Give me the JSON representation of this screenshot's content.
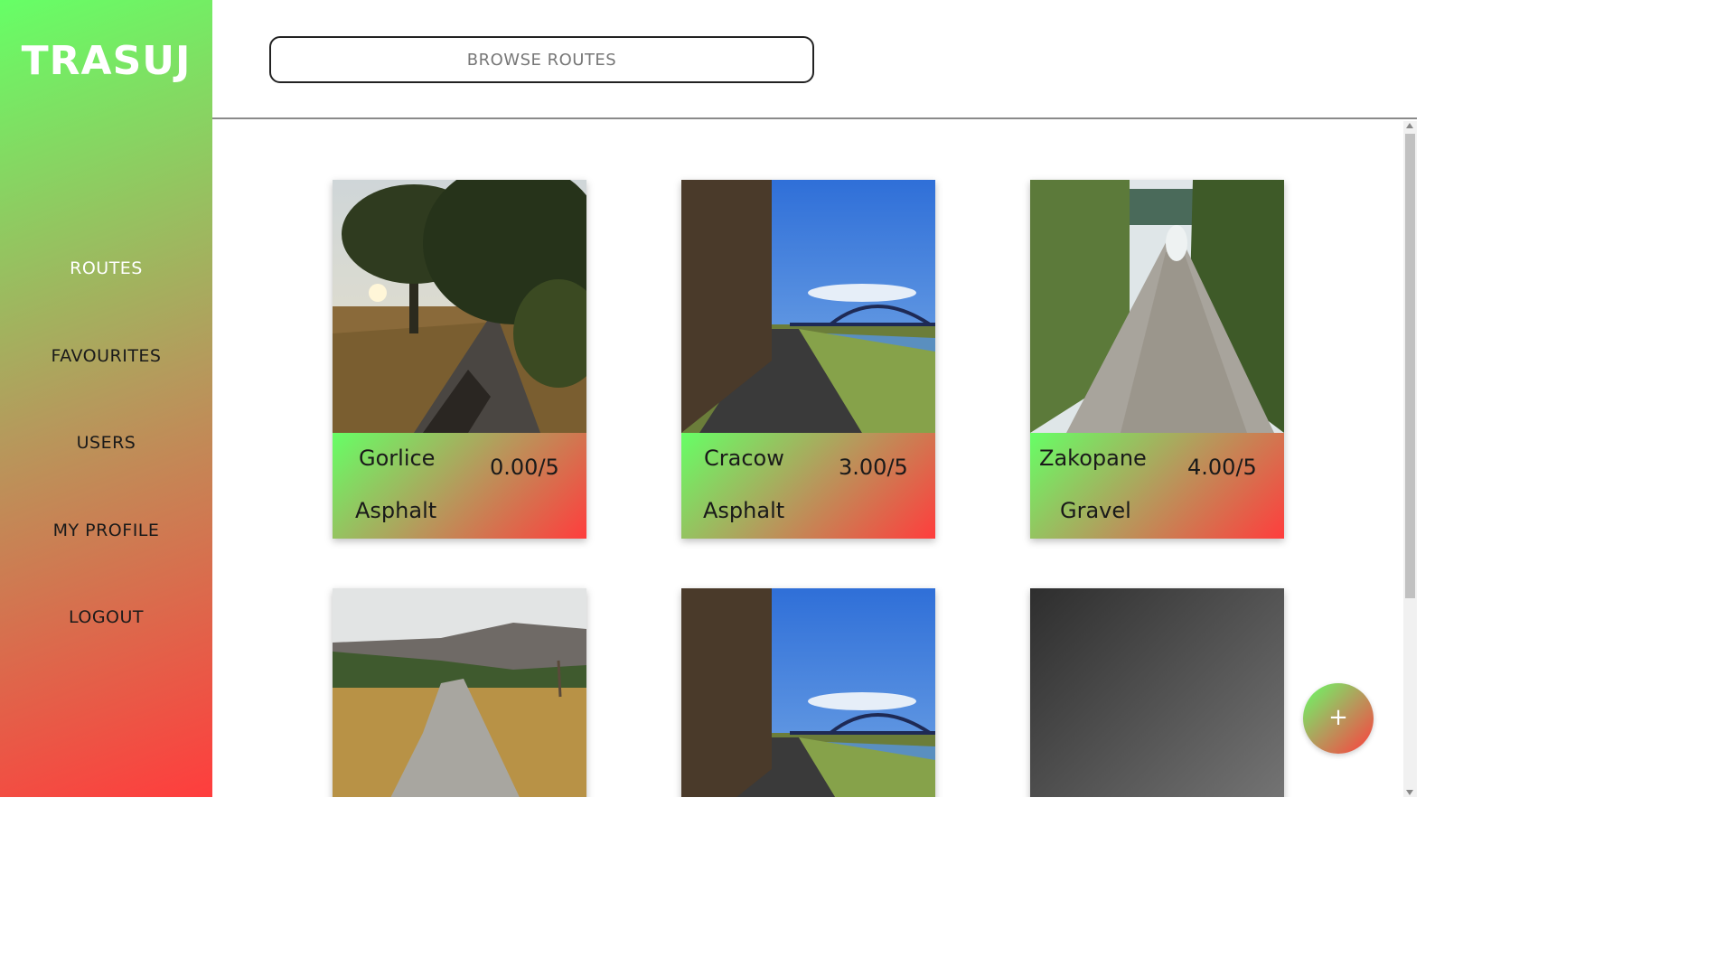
{
  "app": {
    "logo": "TRASUJ"
  },
  "sidebar": {
    "items": [
      {
        "label": "ROUTES"
      },
      {
        "label": "FAVOURITES"
      },
      {
        "label": "USERS"
      },
      {
        "label": "MY PROFILE"
      },
      {
        "label": "LOGOUT"
      }
    ]
  },
  "search": {
    "placeholder": "BROWSE ROUTES"
  },
  "routes": [
    {
      "city": "Gorlice",
      "rating": "0.00/5",
      "surface": "Asphalt"
    },
    {
      "city": "Cracow",
      "rating": "3.00/5",
      "surface": "Asphalt"
    },
    {
      "city": "Zakopane",
      "rating": "4.00/5",
      "surface": "Gravel"
    }
  ],
  "fab": {
    "label": "+"
  },
  "colors": {
    "gradient_green": "#66ff66",
    "gradient_red": "#ff3d3d"
  }
}
